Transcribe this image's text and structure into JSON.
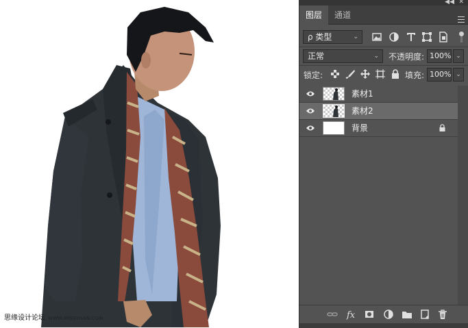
{
  "watermark": {
    "text": "思缘设计论坛",
    "url": "WWW.MISSYUAN.COM"
  },
  "panel": {
    "tabs": [
      {
        "label": "图层"
      },
      {
        "label": "通道"
      }
    ],
    "filter": {
      "selected": "ρ 类型"
    },
    "blend_mode": {
      "selected": "正常"
    },
    "opacity": {
      "label": "不透明度:",
      "value": "100%"
    },
    "lock": {
      "label": "锁定:"
    },
    "fill": {
      "label": "填充:",
      "value": "100%"
    },
    "layers": [
      {
        "name": "素材1",
        "visible": true,
        "selected": false,
        "thumb": "transparent"
      },
      {
        "name": "素材2",
        "visible": true,
        "selected": true,
        "thumb": "transparent"
      },
      {
        "name": "背景",
        "visible": true,
        "selected": false,
        "locked": true,
        "thumb": "white"
      }
    ]
  },
  "icons": {
    "filter_icons": [
      "image-filter-icon",
      "adjustment-filter-icon",
      "type-filter-icon",
      "shape-filter-icon",
      "smart-object-filter-icon"
    ],
    "lock_icons": [
      "lock-transparent-pixels-icon",
      "lock-image-pixels-icon",
      "lock-position-icon",
      "lock-artboard-icon",
      "lock-all-icon"
    ],
    "bottom_icons": [
      "link-layers-icon",
      "fx-icon",
      "add-mask-icon",
      "new-adjustment-icon",
      "new-group-icon",
      "new-layer-icon",
      "delete-layer-icon"
    ]
  },
  "colors": {
    "panel_bg": "#535353",
    "selected_layer": "#6a6a6a",
    "canvas_bg": "#ffffff"
  }
}
